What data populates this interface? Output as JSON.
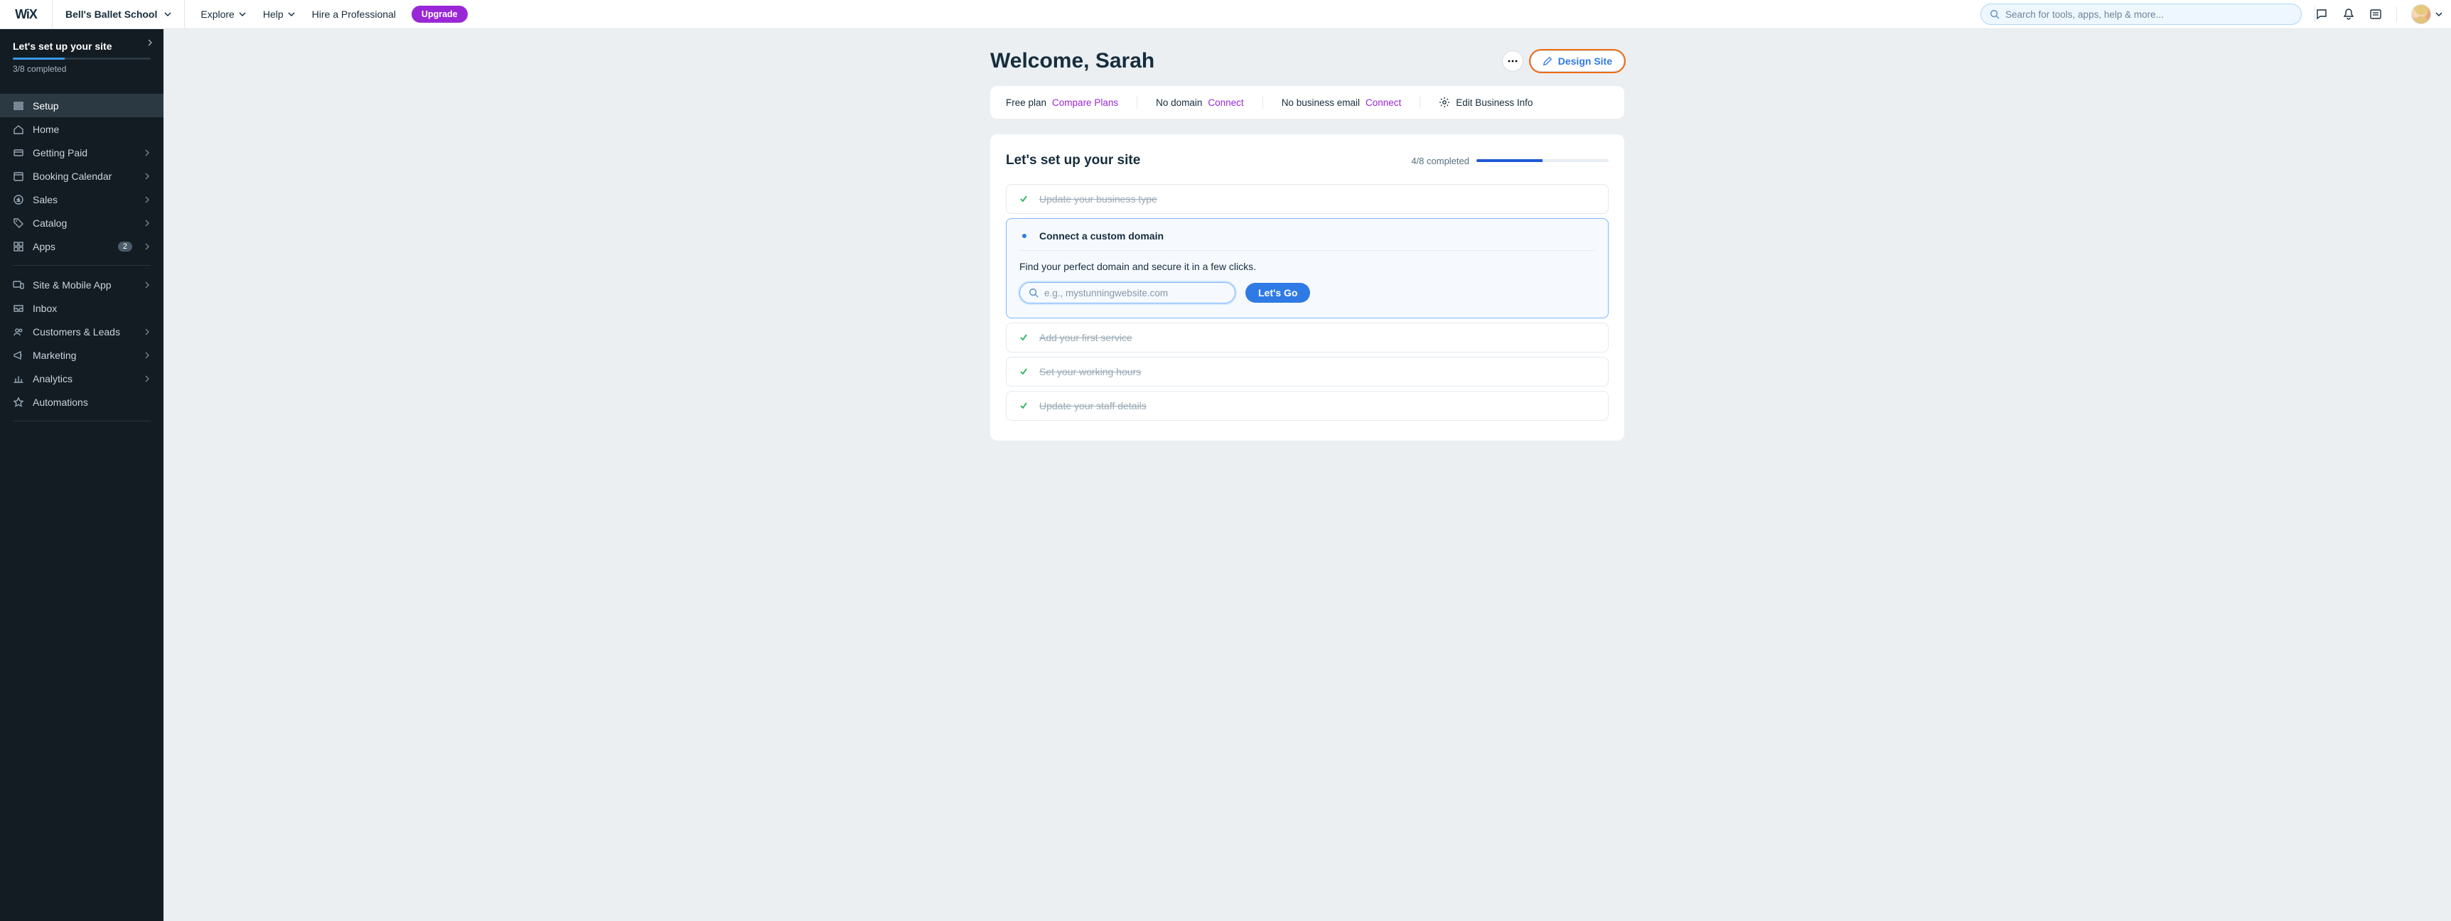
{
  "topbar": {
    "logo_text": "WiX",
    "site_name": "Bell's Ballet School",
    "nav": {
      "explore": "Explore",
      "help": "Help",
      "hire": "Hire a Professional"
    },
    "upgrade_label": "Upgrade",
    "search_placeholder": "Search for tools, apps, help & more..."
  },
  "sidebar": {
    "setup_card": {
      "title": "Let's set up your site",
      "progress_text": "3/8 completed",
      "progress_pct": 37.5
    },
    "items": [
      {
        "label": "Setup",
        "icon": "list-icon",
        "has_chevron": false,
        "active": true
      },
      {
        "label": "Home",
        "icon": "home-icon",
        "has_chevron": false,
        "active": false
      },
      {
        "label": "Getting Paid",
        "icon": "card-icon",
        "has_chevron": true,
        "active": false
      },
      {
        "label": "Booking Calendar",
        "icon": "calendar-icon",
        "has_chevron": true,
        "active": false
      },
      {
        "label": "Sales",
        "icon": "dollar-icon",
        "has_chevron": true,
        "active": false
      },
      {
        "label": "Catalog",
        "icon": "tag-icon",
        "has_chevron": true,
        "active": false
      },
      {
        "label": "Apps",
        "icon": "grid-icon",
        "has_chevron": true,
        "active": false,
        "badge": "2"
      }
    ],
    "items2": [
      {
        "label": "Site & Mobile App",
        "icon": "devices-icon",
        "has_chevron": true
      },
      {
        "label": "Inbox",
        "icon": "inbox-icon",
        "has_chevron": false
      },
      {
        "label": "Customers & Leads",
        "icon": "users-icon",
        "has_chevron": true
      },
      {
        "label": "Marketing",
        "icon": "megaphone-icon",
        "has_chevron": true
      },
      {
        "label": "Analytics",
        "icon": "chart-icon",
        "has_chevron": true
      },
      {
        "label": "Automations",
        "icon": "automation-icon",
        "has_chevron": false
      }
    ]
  },
  "main": {
    "welcome": "Welcome, Sarah",
    "design_site_label": "Design Site",
    "status": {
      "plan_label": "Free plan",
      "plan_link": "Compare Plans",
      "domain_label": "No domain",
      "domain_link": "Connect",
      "email_label": "No business email",
      "email_link": "Connect",
      "edit_biz_label": "Edit Business Info"
    },
    "panel": {
      "title": "Let's set up your site",
      "progress_text": "4/8 completed",
      "progress_pct": 50,
      "steps": {
        "done1": "Update your business type",
        "active": {
          "title": "Connect a custom domain",
          "desc": "Find your perfect domain and secure it in a few clicks.",
          "placeholder": "e.g., mystunningwebsite.com",
          "button": "Let's Go"
        },
        "done2": "Add your first service",
        "done3": "Set your working hours",
        "done4": "Update your staff details"
      }
    }
  }
}
